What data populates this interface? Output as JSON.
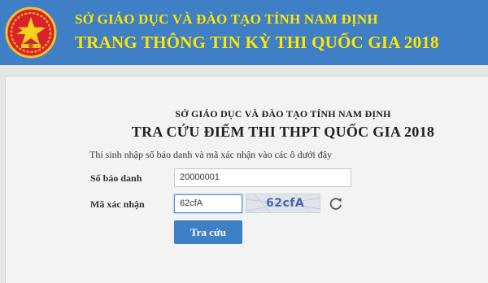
{
  "banner": {
    "line1": "SỞ GIÁO DỤC VÀ ĐÀO TẠO TỈNH NAM ĐỊNH",
    "line2": "TRANG THÔNG TIN KỲ THI QUỐC GIA 2018",
    "background_color": "#3e7fc6",
    "text_color": "#ffe600",
    "emblem_icon": "national-emblem-icon"
  },
  "form": {
    "org_title": "SỞ GIÁO DỤC VÀ ĐÀO TẠO TỈNH NAM ĐỊNH",
    "page_title": "TRA CỨU ĐIỂM THI THPT QUỐC GIA 2018",
    "instruction": "Thí sinh nhập số báo danh và mã xác nhận vào các ô dưới đây",
    "candidate_number_label": "Số báo danh",
    "candidate_number_value": "20000001",
    "captcha_label": "Mã xác nhận",
    "captcha_input_value": "62cfA",
    "captcha_image_text": "62cfA",
    "refresh_icon": "refresh-icon",
    "submit_label": "Tra cứu",
    "button_color": "#3e80c6"
  }
}
